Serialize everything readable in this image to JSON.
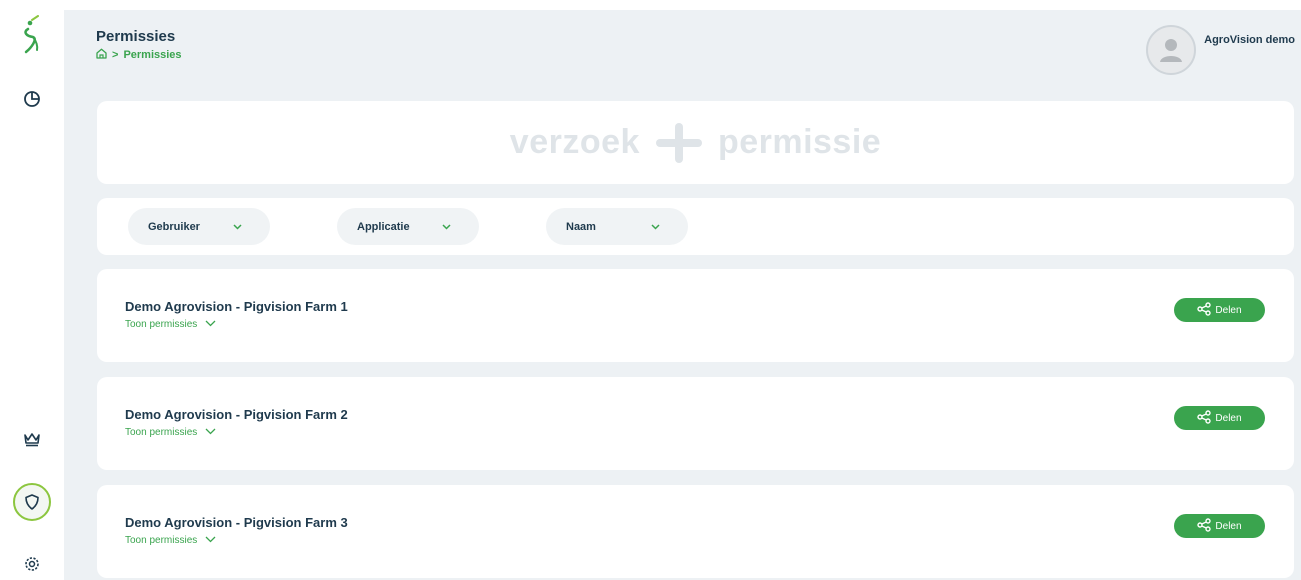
{
  "page": {
    "title": "Permissies"
  },
  "breadcrumb": {
    "home_icon": "home-icon",
    "separator": ">",
    "current": "Permissies"
  },
  "user": {
    "name": "AgroVision demo",
    "avatar_icon": "user-avatar-icon"
  },
  "request": {
    "left_text": "verzoek",
    "right_text": "permissie",
    "icon": "plus-icon"
  },
  "filters": [
    {
      "label": "Gebruiker"
    },
    {
      "label": "Applicatie"
    },
    {
      "label": "Naam"
    }
  ],
  "farms": [
    {
      "title": "Demo Agrovision - Pigvision Farm 1",
      "toggle": "Toon permissies",
      "share": "Delen"
    },
    {
      "title": "Demo Agrovision - Pigvision Farm 2",
      "toggle": "Toon permissies",
      "share": "Delen"
    },
    {
      "title": "Demo Agrovision - Pigvision Farm 3",
      "toggle": "Toon permissies",
      "share": "Delen"
    }
  ],
  "sidebar": {
    "logo": "agrovision-logo",
    "items": [
      {
        "icon": "pie-chart-icon"
      },
      {
        "icon": "crown-icon"
      },
      {
        "icon": "shield-icon",
        "active": true
      },
      {
        "icon": "gear-icon"
      }
    ]
  },
  "colors": {
    "accent": "#3aa44e",
    "text": "#1f3a4d",
    "background": "#edf1f4",
    "card": "#ffffff"
  }
}
